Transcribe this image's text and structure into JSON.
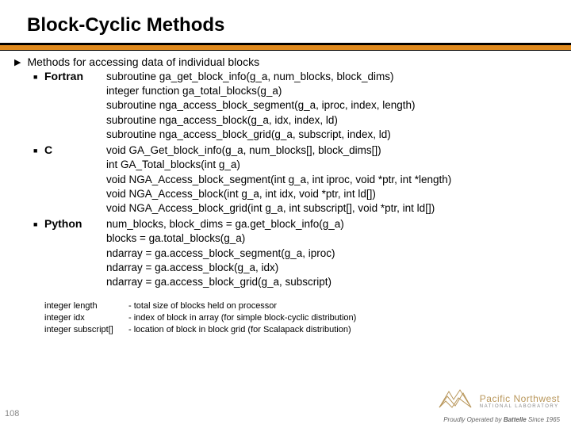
{
  "title": "Block-Cyclic Methods",
  "heading": "Methods for accessing data of individual blocks",
  "sections": [
    {
      "label": "Fortran",
      "lines": [
        "subroutine ga_get_block_info(g_a, num_blocks, block_dims)",
        "integer function ga_total_blocks(g_a)",
        "subroutine nga_access_block_segment(g_a, iproc, index, length)",
        "subroutine nga_access_block(g_a, idx, index, ld)",
        "subroutine nga_access_block_grid(g_a, subscript, index, ld)"
      ]
    },
    {
      "label": "C",
      "lines": [
        "void GA_Get_block_info(g_a, num_blocks[], block_dims[])",
        "int GA_Total_blocks(int g_a)",
        "void NGA_Access_block_segment(int g_a, int iproc, void *ptr, int *length)",
        "void NGA_Access_block(int g_a, int idx, void *ptr, int ld[])",
        "void NGA_Access_block_grid(int g_a, int subscript[], void *ptr, int ld[])"
      ]
    },
    {
      "label": "Python",
      "lines": [
        "num_blocks, block_dims = ga.get_block_info(g_a)",
        "blocks = ga.total_blocks(g_a)",
        "ndarray = ga.access_block_segment(g_a, iproc)",
        "ndarray = ga.access_block(g_a, idx)",
        "ndarray = ga.access_block_grid(g_a, subscript)"
      ]
    }
  ],
  "notes": [
    {
      "term": "integer length",
      "desc": "- total size of blocks held on processor"
    },
    {
      "term": "integer idx",
      "desc": "- index of block in array (for simple block-cyclic distribution)"
    },
    {
      "term": "integer subscript[]",
      "desc": "- location of block in block grid (for Scalapack distribution)"
    }
  ],
  "page": "108",
  "logo": {
    "line1": "Pacific Northwest",
    "line2": "NATIONAL LABORATORY",
    "tagline_prefix": "Proudly Operated by ",
    "tagline_brand": "Battelle",
    "tagline_suffix": " Since 1965"
  }
}
